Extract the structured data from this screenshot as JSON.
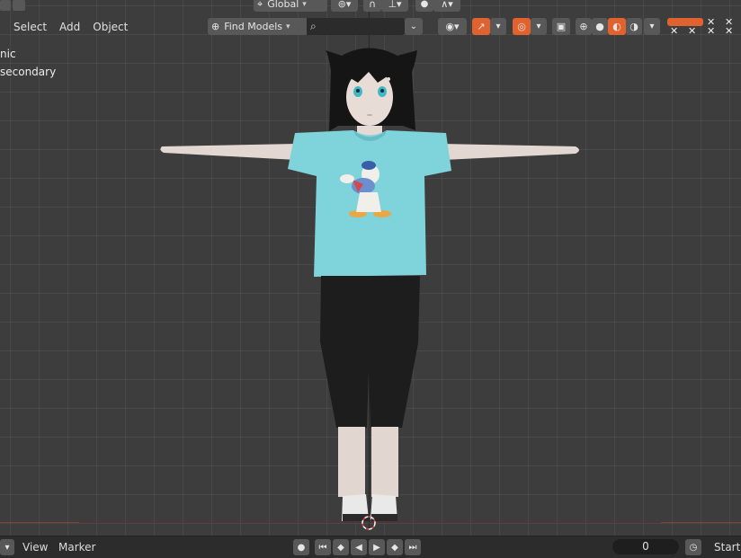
{
  "menu": {
    "select": "Select",
    "add": "Add",
    "object": "Object"
  },
  "mode_lines": {
    "line1": "nic",
    "line2": "secondary"
  },
  "header": {
    "orientation": "Global",
    "search_scope": "Find Models",
    "search_placeholder": ""
  },
  "timeline": {
    "view": "View",
    "marker": "Marker",
    "current_frame": "0",
    "start_label": "Start"
  },
  "colors": {
    "viewport_bg": "#3d3d3d",
    "active_orange": "#e0622f",
    "shirt": "#7fd1d8",
    "pants": "#1c1c1c",
    "skin": "#e8dcd6"
  }
}
